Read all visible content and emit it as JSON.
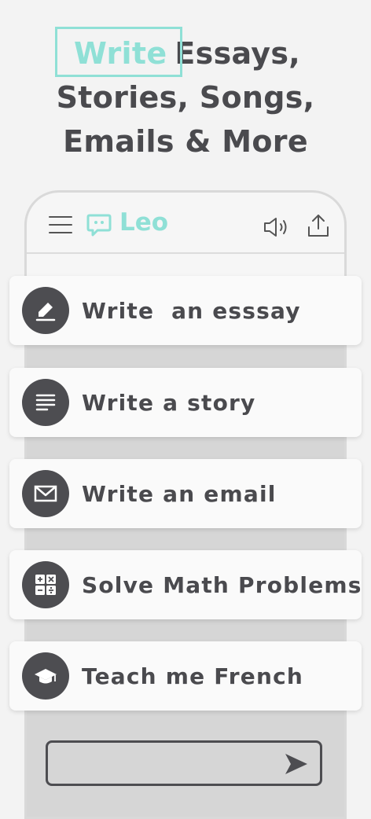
{
  "headline": {
    "highlight": "Write",
    "line1_rest": "Essays,",
    "line2": "Stories, Songs,",
    "line3": "Emails & More"
  },
  "app": {
    "name": "Leo"
  },
  "prompts": [
    {
      "label": "Write  an esssay",
      "icon": "pen-icon"
    },
    {
      "label": "Write a story",
      "icon": "lines-icon"
    },
    {
      "label": "Write an email",
      "icon": "envelope-icon"
    },
    {
      "label": "Solve Math Problems",
      "icon": "calculator-icon"
    },
    {
      "label": "Teach me French",
      "icon": "graduation-cap-icon"
    }
  ],
  "input": {
    "placeholder": ""
  },
  "colors": {
    "accent": "#8fe0d6",
    "text_dark": "#4a4a4e",
    "icon_bg": "#4d4d51",
    "background": "#f3f3f3"
  }
}
